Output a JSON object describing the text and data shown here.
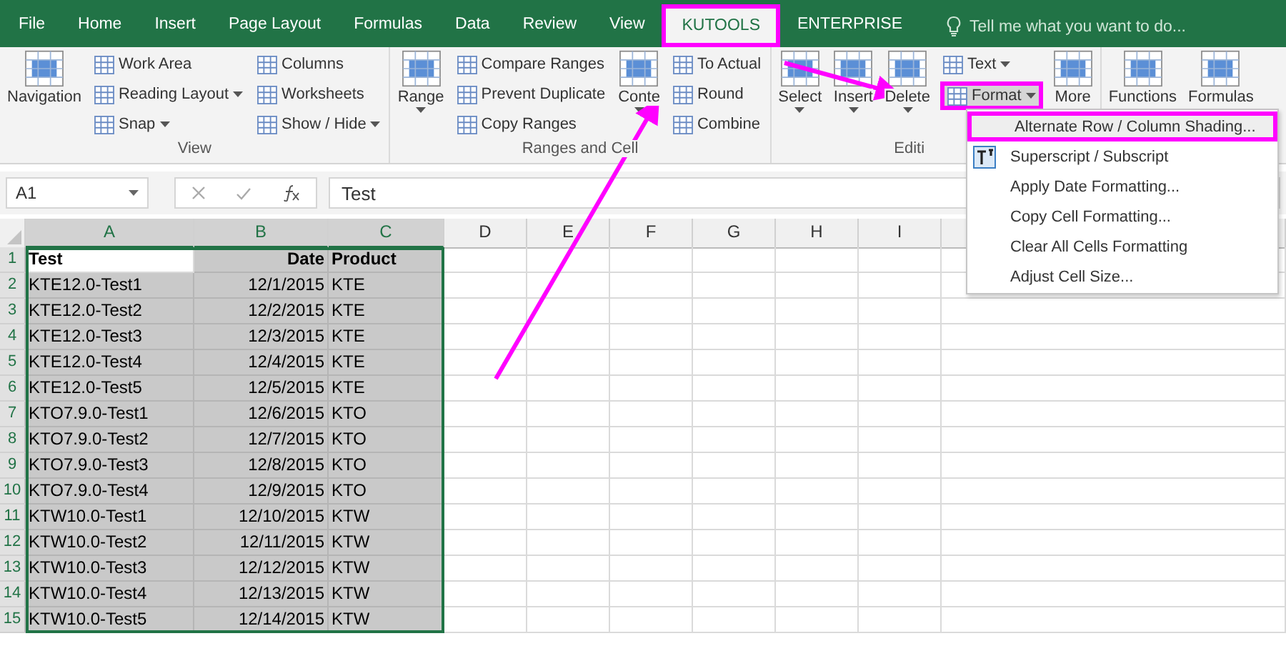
{
  "tabs": [
    {
      "label": "File",
      "selected": false,
      "highlighted": false
    },
    {
      "label": "Home",
      "selected": false,
      "highlighted": false
    },
    {
      "label": "Insert",
      "selected": false,
      "highlighted": false
    },
    {
      "label": "Page Layout",
      "selected": false,
      "highlighted": false
    },
    {
      "label": "Formulas",
      "selected": false,
      "highlighted": false
    },
    {
      "label": "Data",
      "selected": false,
      "highlighted": false
    },
    {
      "label": "Review",
      "selected": false,
      "highlighted": false
    },
    {
      "label": "View",
      "selected": false,
      "highlighted": false
    },
    {
      "label": "KUTOOLS",
      "selected": true,
      "highlighted": true
    },
    {
      "label": "ENTERPRISE",
      "selected": false,
      "highlighted": false
    }
  ],
  "tell_me": {
    "placeholder": "Tell me what you want to do..."
  },
  "ribbon": [
    {
      "label": "View",
      "controls": [
        {
          "kind": "large",
          "label": "Navigation",
          "dropdown": false,
          "highlighted": false
        },
        {
          "kind": "small",
          "label": "Work Area",
          "dropdown": false,
          "highlighted": false
        },
        {
          "kind": "small",
          "label": "Reading Layout",
          "dropdown": true,
          "highlighted": false
        },
        {
          "kind": "small",
          "label": "Snap",
          "dropdown": true,
          "highlighted": false
        },
        {
          "kind": "small",
          "label": "Columns",
          "dropdown": false,
          "highlighted": false
        },
        {
          "kind": "small",
          "label": "Worksheets",
          "dropdown": false,
          "highlighted": false
        },
        {
          "kind": "small",
          "label": "Show / Hide",
          "dropdown": true,
          "highlighted": false
        }
      ]
    },
    {
      "label": "Ranges and Cell",
      "controls": [
        {
          "kind": "large",
          "label": "Range",
          "dropdown": true,
          "highlighted": false
        },
        {
          "kind": "small",
          "label": "Compare Ranges",
          "dropdown": false,
          "highlighted": false
        },
        {
          "kind": "small",
          "label": "Prevent Duplicate",
          "dropdown": false,
          "highlighted": false
        },
        {
          "kind": "small",
          "label": "Copy Ranges",
          "dropdown": false,
          "highlighted": false
        },
        {
          "kind": "large",
          "label": "Conte",
          "dropdown": true,
          "highlighted": false
        },
        {
          "kind": "small",
          "label": "To Actual",
          "dropdown": false,
          "highlighted": false
        },
        {
          "kind": "small",
          "label": "Round",
          "dropdown": false,
          "highlighted": false
        },
        {
          "kind": "small",
          "label": "Combine",
          "dropdown": false,
          "highlighted": false
        }
      ]
    },
    {
      "label": "Editi",
      "controls": [
        {
          "kind": "large",
          "label": "Select",
          "dropdown": true,
          "highlighted": false
        },
        {
          "kind": "large",
          "label": "Insert",
          "dropdown": true,
          "highlighted": false
        },
        {
          "kind": "large",
          "label": "Delete",
          "dropdown": true,
          "highlighted": false
        },
        {
          "kind": "small",
          "label": "Text",
          "dropdown": true,
          "highlighted": false
        },
        {
          "kind": "small",
          "label": "Format",
          "dropdown": true,
          "highlighted": true
        },
        {
          "kind": "large",
          "label": "More",
          "dropdown": false,
          "highlighted": false
        }
      ]
    },
    {
      "controls": [
        {
          "kind": "large",
          "label": "Functions",
          "dropdown": false,
          "highlighted": false
        },
        {
          "kind": "large",
          "label": "Formulas",
          "dropdown": false,
          "highlighted": false
        }
      ]
    }
  ],
  "menu": [
    {
      "kind": "plain",
      "label": "Alternate Row / Column Shading...",
      "highlighted": true
    },
    {
      "kind": "icon",
      "label": "Superscript / Subscript",
      "highlighted": false
    },
    {
      "kind": "plain",
      "label": "Apply Date Formatting...",
      "highlighted": false
    },
    {
      "kind": "plain",
      "label": "Copy Cell Formatting...",
      "highlighted": false
    },
    {
      "kind": "plain",
      "label": "Clear All Cells Formatting",
      "highlighted": false
    },
    {
      "kind": "plain",
      "label": "Adjust Cell Size...",
      "highlighted": false
    }
  ],
  "formula_bar": {
    "name_box": "A1",
    "value": "Test"
  },
  "sheet": {
    "columns": [
      {
        "label": "A",
        "selected": true
      },
      {
        "label": "B",
        "selected": true
      },
      {
        "label": "C",
        "selected": true
      },
      {
        "label": "D",
        "selected": false
      },
      {
        "label": "E",
        "selected": false
      },
      {
        "label": "F",
        "selected": false
      },
      {
        "label": "G",
        "selected": false
      },
      {
        "label": "H",
        "selected": false
      },
      {
        "label": "I",
        "selected": false
      }
    ],
    "rows": [
      {
        "number": "1",
        "selected": true,
        "bold": true,
        "cells": [
          "Test",
          "Date",
          "Product"
        ]
      },
      {
        "number": "2",
        "selected": true,
        "bold": false,
        "cells": [
          "KTE12.0-Test1",
          "12/1/2015",
          "KTE"
        ]
      },
      {
        "number": "3",
        "selected": true,
        "bold": false,
        "cells": [
          "KTE12.0-Test2",
          "12/2/2015",
          "KTE"
        ]
      },
      {
        "number": "4",
        "selected": true,
        "bold": false,
        "cells": [
          "KTE12.0-Test3",
          "12/3/2015",
          "KTE"
        ]
      },
      {
        "number": "5",
        "selected": true,
        "bold": false,
        "cells": [
          "KTE12.0-Test4",
          "12/4/2015",
          "KTE"
        ]
      },
      {
        "number": "6",
        "selected": true,
        "bold": false,
        "cells": [
          "KTE12.0-Test5",
          "12/5/2015",
          "KTE"
        ]
      },
      {
        "number": "7",
        "selected": true,
        "bold": false,
        "cells": [
          "KTO7.9.0-Test1",
          "12/6/2015",
          "KTO"
        ]
      },
      {
        "number": "8",
        "selected": true,
        "bold": false,
        "cells": [
          "KTO7.9.0-Test2",
          "12/7/2015",
          "KTO"
        ]
      },
      {
        "number": "9",
        "selected": true,
        "bold": false,
        "cells": [
          "KTO7.9.0-Test3",
          "12/8/2015",
          "KTO"
        ]
      },
      {
        "number": "10",
        "selected": true,
        "bold": false,
        "cells": [
          "KTO7.9.0-Test4",
          "12/9/2015",
          "KTO"
        ]
      },
      {
        "number": "11",
        "selected": true,
        "bold": false,
        "cells": [
          "KTW10.0-Test1",
          "12/10/2015",
          "KTW"
        ]
      },
      {
        "number": "12",
        "selected": true,
        "bold": false,
        "cells": [
          "KTW10.0-Test2",
          "12/11/2015",
          "KTW"
        ]
      },
      {
        "number": "13",
        "selected": true,
        "bold": false,
        "cells": [
          "KTW10.0-Test3",
          "12/12/2015",
          "KTW"
        ]
      },
      {
        "number": "14",
        "selected": true,
        "bold": false,
        "cells": [
          "KTW10.0-Test4",
          "12/13/2015",
          "KTW"
        ]
      },
      {
        "number": "15",
        "selected": true,
        "bold": false,
        "cells": [
          "KTW10.0-Test5",
          "12/14/2015",
          "KTW"
        ]
      }
    ]
  }
}
